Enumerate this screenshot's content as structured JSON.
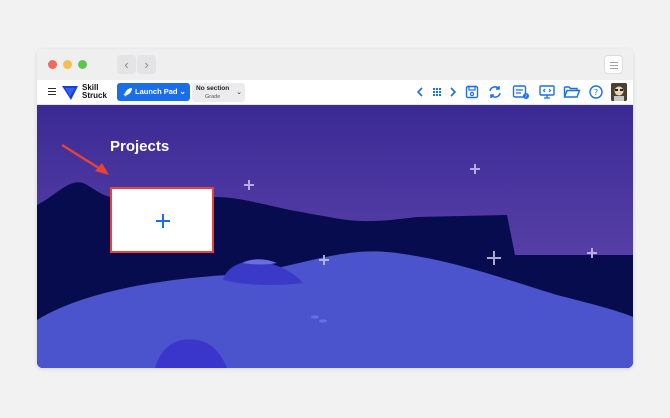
{
  "browser": {
    "back_glyph": "‹",
    "forward_glyph": "›"
  },
  "app": {
    "logo_line1": "Skill",
    "logo_line2": "Struck",
    "launch_pad_label": "Launch Pad",
    "section_label": "No section",
    "section_sublabel": "Grade",
    "icons": [
      "chevron-left-icon",
      "apps-grid-icon",
      "chevron-right-icon",
      "save-icon",
      "sync-icon",
      "code-settings-icon",
      "present-icon",
      "folder-open-icon",
      "help-icon"
    ]
  },
  "main": {
    "title": "Projects",
    "new_project_icon": "plus-icon"
  },
  "colors": {
    "brand_blue": "#1a6ee8",
    "sky_top": "#3b2a94",
    "sky_bottom": "#6a4fb5",
    "mountain": "#070c4f",
    "ground": "#4b54cc",
    "highlight_border": "#e8433a"
  }
}
